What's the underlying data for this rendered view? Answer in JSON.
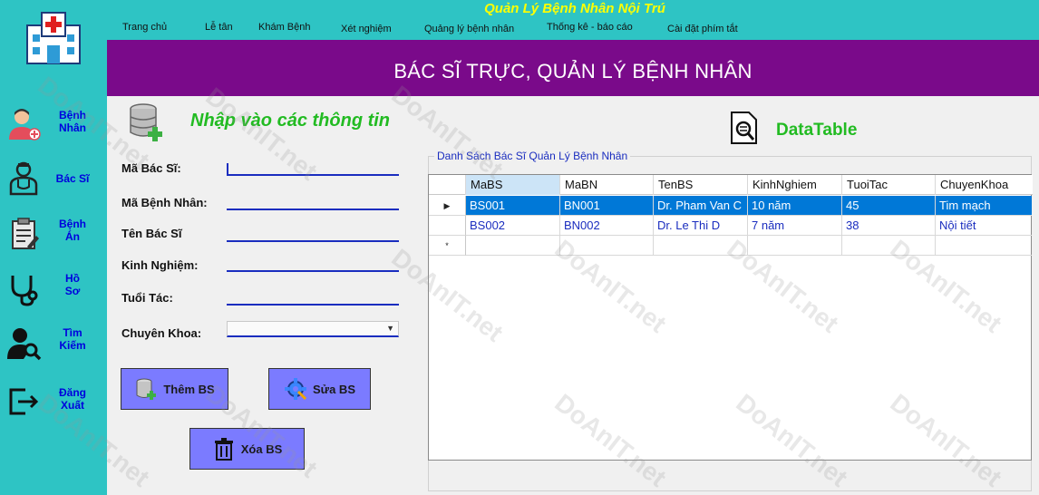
{
  "app": {
    "title": "Quản Lý Bệnh Nhân Nội Trú"
  },
  "menu": [
    {
      "label": "Trang chủ"
    },
    {
      "label": "Lễ tân"
    },
    {
      "label": "Khám Bệnh"
    },
    {
      "label": "Xét nghiệm"
    },
    {
      "label": "Quảng lý bệnh nhân"
    },
    {
      "label": "Thống kê - báo cáo"
    },
    {
      "label": "Cài đặt phím tắt"
    }
  ],
  "sidebar": {
    "items": [
      {
        "label": "Bệnh\nNhân",
        "icon": "patient-icon"
      },
      {
        "label": "Bác Sĩ",
        "icon": "doctor-icon"
      },
      {
        "label": "Bệnh\nÁn",
        "icon": "medical-record-icon"
      },
      {
        "label": "Hồ\nSơ",
        "icon": "stethoscope-icon"
      },
      {
        "label": "Tìm\nKiếm",
        "icon": "search-user-icon"
      },
      {
        "label": "Đăng\nXuất",
        "icon": "logout-icon"
      }
    ]
  },
  "banner": {
    "title": "BÁC SĨ TRỰC, QUẢN LÝ BỆNH NHÂN"
  },
  "form": {
    "heading": "Nhập vào các thông tin",
    "fields": {
      "ma_bac_si": {
        "label": "Mã Bác Sĩ:",
        "value": ""
      },
      "ma_benh_nhan": {
        "label": "Mã Bệnh Nhân:",
        "value": ""
      },
      "ten_bac_si": {
        "label": "Tên Bác Sĩ",
        "value": ""
      },
      "kinh_nghiem": {
        "label": "Kinh Nghiệm:",
        "value": ""
      },
      "tuoi_tac": {
        "label": "Tuổi Tác:",
        "value": ""
      },
      "chuyen_khoa": {
        "label": "Chuyên Khoa:",
        "value": ""
      }
    },
    "buttons": {
      "add": "Thêm BS",
      "edit": "Sửa BS",
      "delete": "Xóa BS"
    }
  },
  "datatable": {
    "title": "DataTable",
    "group_caption": "Danh Sách Bác Sĩ Quản Lý Bệnh Nhân",
    "columns": [
      "MaBS",
      "MaBN",
      "TenBS",
      "KinhNghiem",
      "TuoiTac",
      "ChuyenKhoa"
    ],
    "rows": [
      [
        "BS001",
        "BN001",
        "Dr. Pham Van C",
        "10 năm",
        "45",
        "Tim mạch"
      ],
      [
        "BS002",
        "BN002",
        "Dr. Le Thi D",
        "7 năm",
        "38",
        "Nội tiết"
      ]
    ],
    "selected_row_marker": "▶",
    "new_row_marker": "*"
  },
  "watermark": {
    "text": "DoAnIT.net"
  },
  "colors": {
    "accent_teal": "#2ec4c4",
    "banner_purple": "#7a0a8a",
    "heading_green": "#22bb22",
    "button_blue": "#7b7bff",
    "selection_blue": "#0078d7"
  }
}
